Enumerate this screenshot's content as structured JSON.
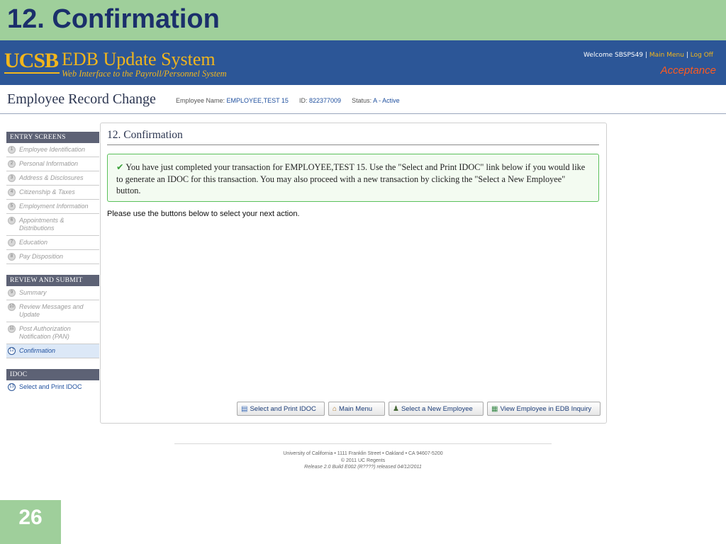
{
  "slide": {
    "title": "12. Confirmation",
    "number": "26"
  },
  "header": {
    "logo": "UCSB",
    "app_title": "EDB Update System",
    "subtitle": "Web Interface to the Payroll/Personnel System",
    "welcome": "Welcome SBSPS49",
    "separator": "|",
    "main_menu_link": "Main Menu",
    "log_off_link": "Log Off",
    "environment": "Acceptance"
  },
  "record": {
    "title": "Employee Record Change",
    "name_label": "Employee Name:",
    "name_value": "EMPLOYEE,TEST 15",
    "id_label": "ID:",
    "id_value": "822377009",
    "status_label": "Status:",
    "status_value": "A - Active"
  },
  "sidebar": {
    "entry_header": "ENTRY SCREENS",
    "entry_items": [
      {
        "num": "1",
        "label": "Employee Identification"
      },
      {
        "num": "2",
        "label": "Personal Information"
      },
      {
        "num": "3",
        "label": "Address & Disclosures"
      },
      {
        "num": "4",
        "label": "Citizenship & Taxes"
      },
      {
        "num": "5",
        "label": "Employment Information"
      },
      {
        "num": "6",
        "label": "Appointments & Distributions"
      },
      {
        "num": "7",
        "label": "Education"
      },
      {
        "num": "8",
        "label": "Pay Disposition"
      }
    ],
    "review_header": "REVIEW AND SUBMIT",
    "review_items": [
      {
        "num": "9",
        "label": "Summary"
      },
      {
        "num": "10",
        "label": "Review Messages and Update"
      },
      {
        "num": "11",
        "label": "Post Authorization Notification (PAN)"
      },
      {
        "num": "12",
        "label": "Confirmation"
      }
    ],
    "idoc_header": "IDOC",
    "idoc_items": [
      {
        "num": "13",
        "label": "Select and Print IDOC"
      }
    ]
  },
  "main": {
    "title": "12. Confirmation",
    "message": "You have just completed your transaction for EMPLOYEE,TEST 15. Use the \"Select and Print IDOC\" link below if you would like to generate an IDOC for this transaction. You may also proceed with a new transaction by clicking the \"Select a New Employee\" button.",
    "instruction": "Please use the buttons below to select your next action.",
    "buttons": {
      "print_idoc": "Select and Print IDOC",
      "main_menu": "Main Menu",
      "new_employee": "Select a New Employee",
      "view_inquiry": "View Employee in EDB Inquiry"
    }
  },
  "footer": {
    "address": "University of California • 1111 Franklin Street • Oakland • CA 94607-5200",
    "copyright": "© 2011 UC Regents",
    "release": "Release 2.0 Build E002 (R????) released 04/12/2011"
  },
  "colors": {
    "slide_green": "#9fcf9b",
    "banner_blue": "#2c5697",
    "brand_gold": "#f2b61c",
    "env_orange": "#ff5a1f",
    "success_border": "#5bc05b"
  }
}
